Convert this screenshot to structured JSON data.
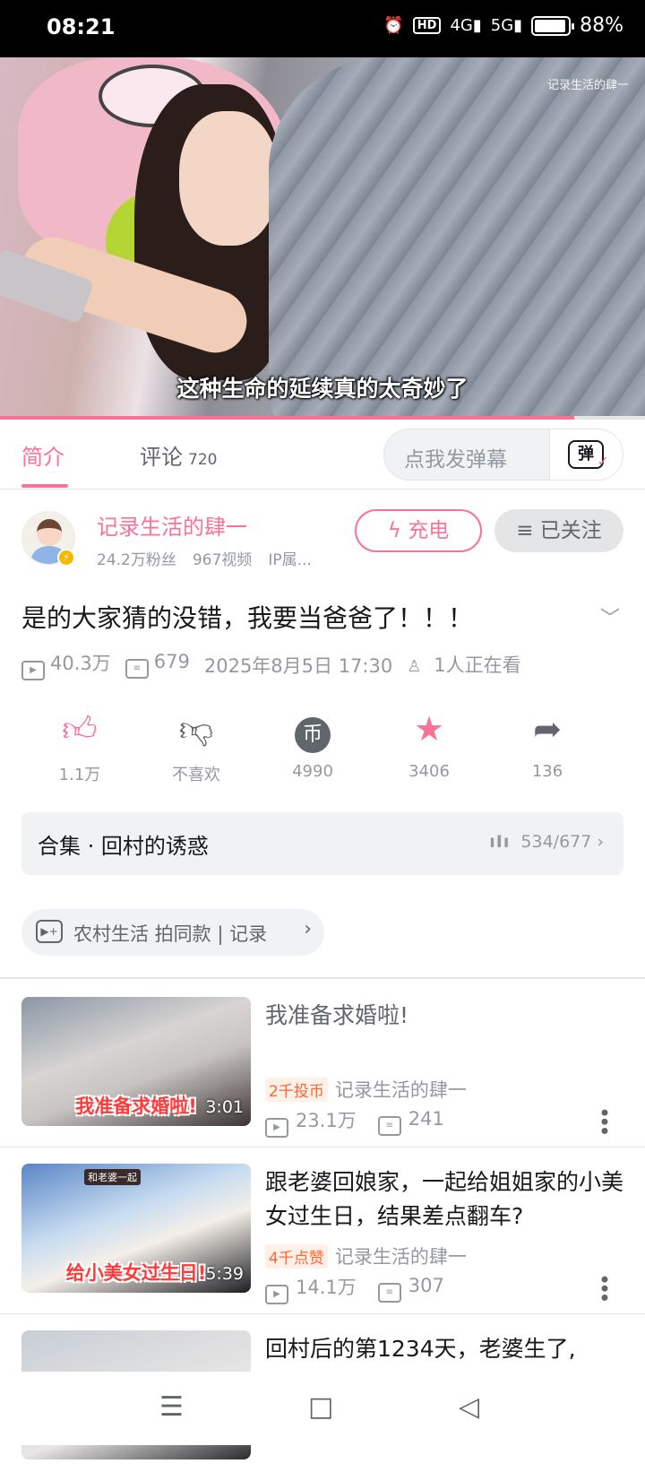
{
  "status_bar": {
    "time": "08:21",
    "alarm_icon": "alarm-icon",
    "hd_label": "HD",
    "signal_1": "4G",
    "signal_2": "5G",
    "battery": "88%"
  },
  "video": {
    "watermark": "记录生活的肆一",
    "subtitle": "这种生命的延续真的太奇妙了",
    "progress_fraction": 0.89
  },
  "tabs": {
    "intro": "简介",
    "comments": "评论",
    "comments_count": "720",
    "danmaku_placeholder": "点我发弹幕",
    "danmaku_icon_label": "弹"
  },
  "uploader": {
    "name": "记录生活的肆一",
    "fans": "24.2万粉丝",
    "videos": "967视频",
    "ip": "IP属...",
    "charge_label": "充电",
    "follow_label": "已关注"
  },
  "video_info": {
    "title": "是的大家猜的没错，我要当爸爸了！！！",
    "views": "40.3万",
    "danmaku_count": "679",
    "date": "2025年8月5日 17:30",
    "watching": "1人正在看"
  },
  "actions": [
    {
      "icon": "thumbs-up-icon",
      "label": "1.1万"
    },
    {
      "icon": "thumbs-down-icon",
      "label": "不喜欢"
    },
    {
      "icon": "coin-icon",
      "label": "4990"
    },
    {
      "icon": "star-icon",
      "label": "3406"
    },
    {
      "icon": "share-icon",
      "label": "136"
    }
  ],
  "collection": {
    "name": "合集 · 回村的诱惑",
    "progress": "534/677"
  },
  "tag": {
    "text": "农村生活    拍同款 | 记录"
  },
  "recommendations": [
    {
      "title": "我准备求婚啦!",
      "thumb_caption": "我准备求婚啦!",
      "duration": "3:01",
      "badge": "2千投币",
      "up": "记录生活的肆一",
      "views": "23.1万",
      "danmaku": "241"
    },
    {
      "title": "跟老婆回娘家，一起给姐姐家的小美女过生日，结果差点翻车?",
      "thumb_caption": "给小美女过生日!",
      "thumb_tag": "和老婆一起",
      "duration": "5:39",
      "badge": "4千点赞",
      "up": "记录生活的肆一",
      "views": "14.1万",
      "danmaku": "307"
    },
    {
      "title": "回村后的第1234天，老婆生了,"
    }
  ],
  "colors": {
    "accent": "#fb7299",
    "text": "#18191c",
    "muted": "#9499a0"
  }
}
